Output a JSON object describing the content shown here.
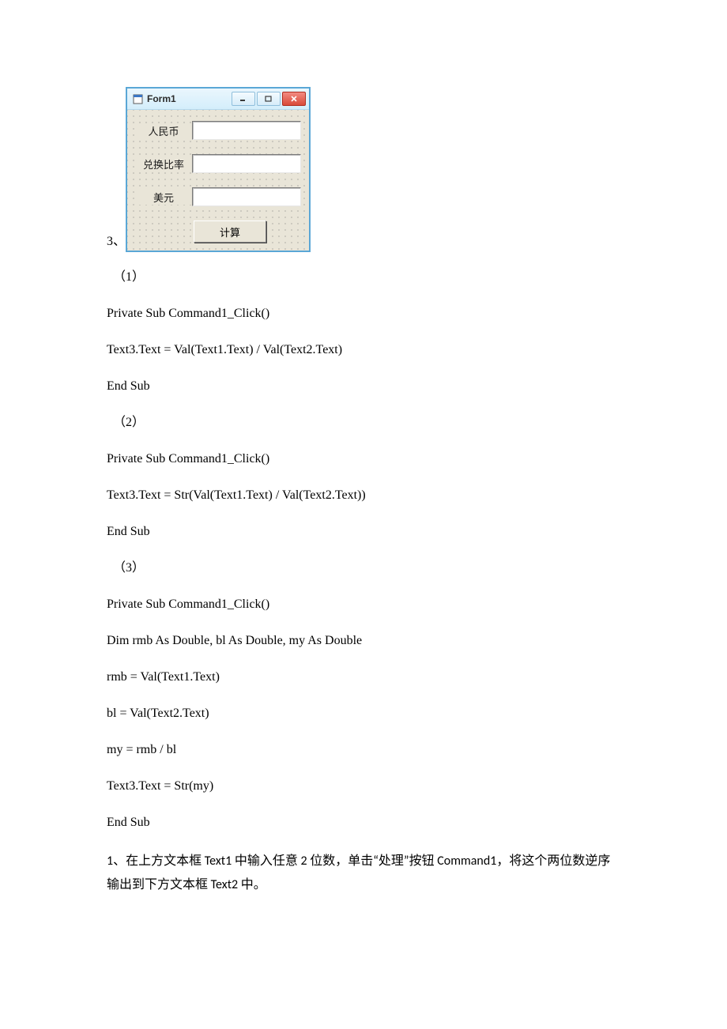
{
  "window": {
    "title": "Form1",
    "labels": {
      "rmb": "人民币",
      "rate": "兑换比率",
      "usd": "美元"
    },
    "button": "计算"
  },
  "doc": {
    "item3_label": "3、",
    "part1_label": "（1）",
    "part2_label": "（2）",
    "part3_label": "（3）",
    "code": {
      "sub_start": "Private Sub Command1_Click()",
      "p1_body": "Text3.Text = Val(Text1.Text) / Val(Text2.Text)",
      "p2_body": "Text3.Text = Str(Val(Text1.Text) / Val(Text2.Text))",
      "p3_dim": "Dim rmb As Double, bl As Double, my As Double",
      "p3_l1": "rmb = Val(Text1.Text)",
      "p3_l2": "bl = Val(Text2.Text)",
      "p3_l3": "my = rmb / bl",
      "p3_l4": "Text3.Text = Str(my)",
      "sub_end": "End Sub"
    },
    "task1": "1、在上方文本框 Text1 中输入任意 2 位数，单击“处理”按钮 Command1，将这个两位数逆序输出到下方文本框 Text2 中。"
  }
}
